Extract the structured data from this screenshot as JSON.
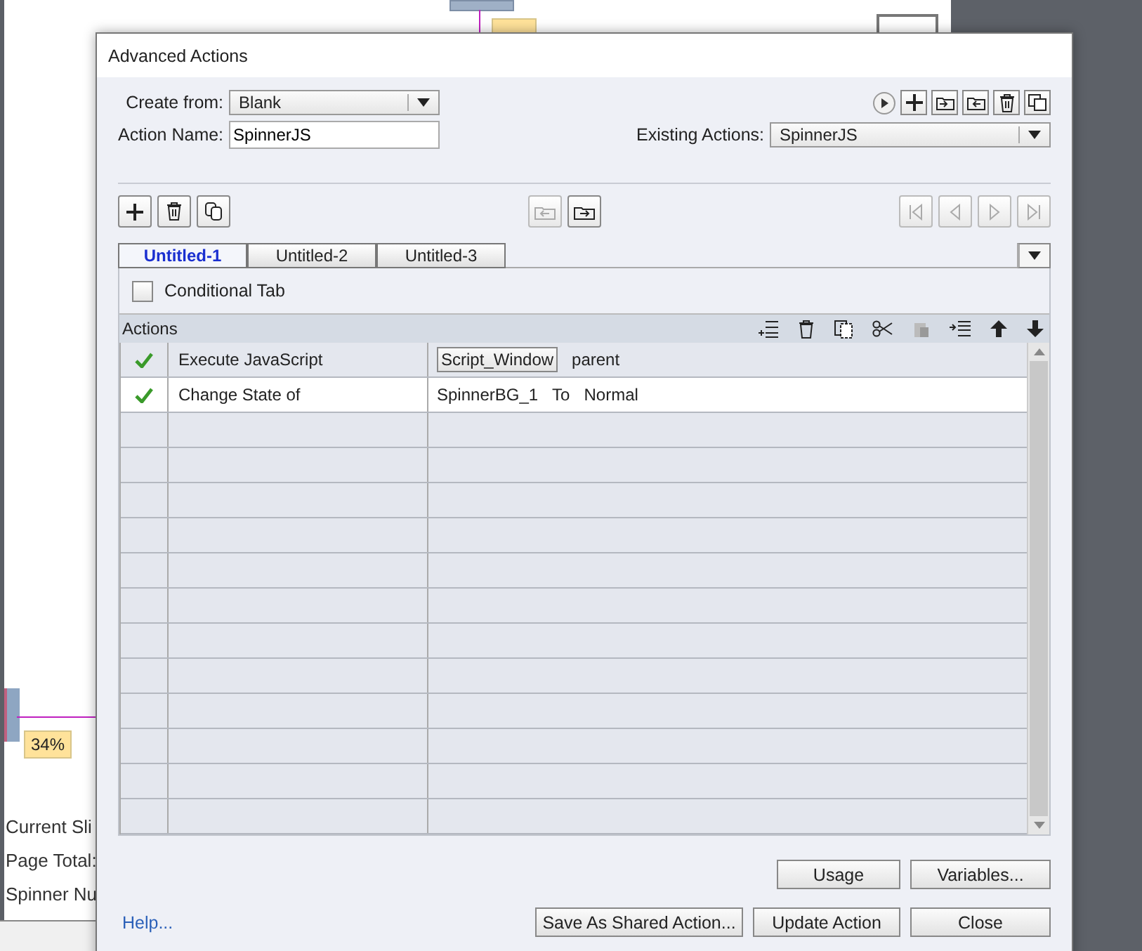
{
  "canvas": {
    "labels": [
      {
        "text": "34%"
      }
    ],
    "texts": [
      "Current Sli",
      "Page Total:",
      "Spinner Nu"
    ]
  },
  "dialog": {
    "title": "Advanced Actions",
    "create_from": {
      "label": "Create from:",
      "value": "Blank"
    },
    "action_name": {
      "label": "Action Name:",
      "value": "SpinnerJS"
    },
    "existing_actions": {
      "label": "Existing Actions:",
      "value": "SpinnerJS"
    },
    "tabs": [
      {
        "label": "Untitled-1",
        "selected": true
      },
      {
        "label": "Untitled-2",
        "selected": false
      },
      {
        "label": "Untitled-3",
        "selected": false
      }
    ],
    "conditional_tab": {
      "label": "Conditional Tab",
      "checked": false
    },
    "actions_header": "Actions",
    "rows": [
      {
        "done": true,
        "action": "Execute JavaScript",
        "selected": false,
        "params": [
          {
            "kind": "button",
            "text": "Script_Window"
          },
          {
            "kind": "text",
            "text": "parent"
          }
        ]
      },
      {
        "done": true,
        "action": "Change State of",
        "selected": true,
        "params": [
          {
            "kind": "text",
            "text": "SpinnerBG_1"
          },
          {
            "kind": "text",
            "text": "To"
          },
          {
            "kind": "text",
            "text": "Normal"
          }
        ]
      }
    ],
    "help": "Help...",
    "buttons_top": [
      "Usage",
      "Variables..."
    ],
    "buttons_bottom": [
      "Save As Shared Action...",
      "Update Action",
      "Close"
    ]
  }
}
